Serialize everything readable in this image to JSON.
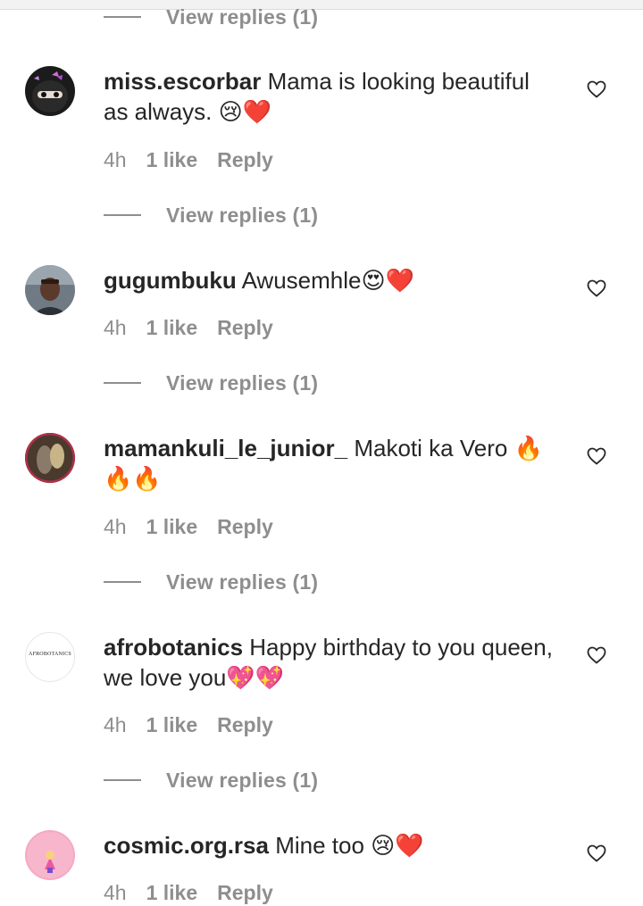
{
  "view_replies_label": "View replies (1)",
  "comments": [
    {
      "username": "miss.escorbar",
      "text": "Mama is looking beautiful as always. 😢❤️",
      "time": "4h",
      "likes": "1 like",
      "reply": "Reply"
    },
    {
      "username": "gugumbuku",
      "text": "Awusemhle😍❤️",
      "time": "4h",
      "likes": "1 like",
      "reply": "Reply"
    },
    {
      "username": "mamankuli_le_junior_",
      "text": "Makoti ka Vero 🔥🔥🔥",
      "time": "4h",
      "likes": "1 like",
      "reply": "Reply"
    },
    {
      "username": "afrobotanics",
      "text": "Happy birthday to you queen, we love you💖💖",
      "time": "4h",
      "likes": "1 like",
      "reply": "Reply",
      "avatar_text": "AFROBOTANICS"
    },
    {
      "username": "cosmic.org.rsa",
      "text": "Mine too 😢❤️",
      "time": "4h",
      "likes": "1 like",
      "reply": "Reply"
    }
  ],
  "colors": {
    "text": "#262626",
    "secondary": "#8e8e8e",
    "background": "#ffffff"
  },
  "icons": {
    "like": "heart-outline-icon"
  }
}
